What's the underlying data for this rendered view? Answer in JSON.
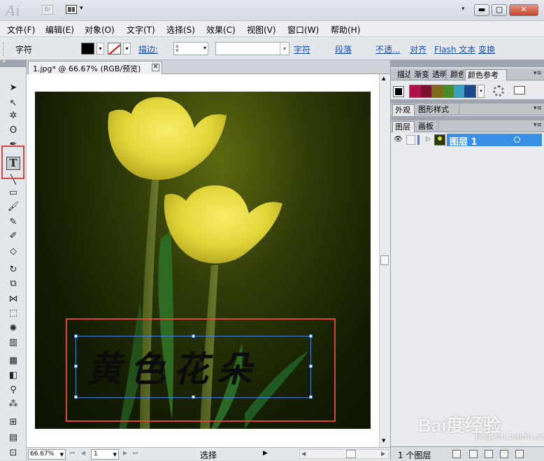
{
  "titlebar": {
    "logo": "Ai",
    "bridge_label": "Br",
    "arrange_dropdown": "▾",
    "workspace_dropdown": "▾",
    "window_buttons": {
      "minimize": "▬",
      "maximize": "▢",
      "close": "✕"
    }
  },
  "menubar": {
    "items": [
      "文件(F)",
      "编辑(E)",
      "对象(O)",
      "文字(T)",
      "选择(S)",
      "效果(C)",
      "视图(V)",
      "窗口(W)",
      "帮助(H)"
    ]
  },
  "controlbar": {
    "tool_label": "字符",
    "fill_color": "#000000",
    "stroke_color": "none",
    "stroke_label": "描边:",
    "stroke_value": "",
    "style_value": "",
    "links": [
      "字符",
      "段落",
      "不透...",
      "对齐",
      "Flash 文本",
      "变换"
    ]
  },
  "tools": {
    "icons": [
      "selection-tool-icon",
      "direct-selection-tool-icon",
      "magic-wand-icon",
      "lasso-icon",
      "pen-icon",
      "type-tool-icon",
      "line-icon",
      "rectangle-icon",
      "paintbrush-icon",
      "pencil-icon",
      "blob-brush-icon",
      "eraser-icon",
      "rotate-icon",
      "scale-icon",
      "width-icon",
      "free-transform-icon",
      "symbol-sprayer-icon",
      "graph-icon",
      "mesh-icon",
      "gradient-icon",
      "eyedropper-icon",
      "blend-icon",
      "slice-icon",
      "hand-icon",
      "artboard-icon"
    ],
    "type_tool_glyph": "T",
    "selected": "type-tool-icon"
  },
  "document": {
    "tab_title": "1.jpg* @ 66.67% (RGB/预览)",
    "tab_close": "✕",
    "artwork_text": "黄色花朵",
    "zoom": "66.67%",
    "page": "1",
    "status": "选择",
    "nav": [
      "⏮",
      "◀",
      "▶",
      "⏭"
    ]
  },
  "panels": {
    "color_tabs": [
      "描边",
      "渐变",
      "透明",
      "颜色",
      "颜色参考"
    ],
    "guide_colors": [
      "#b0104a",
      "#7a1030",
      "#7d6a1a",
      "#4a8a2a",
      "#3aa0c0",
      "#1a4a8a"
    ],
    "appearance_tabs": [
      "外观",
      "图形样式"
    ],
    "layers_tabs": [
      "图层",
      "画板"
    ],
    "layer_name": "图层 1",
    "layer_count": "1 个图层",
    "menu_glyph": "▾≡"
  },
  "watermark": {
    "brand": "Bai度经验",
    "url": "jingyan.baidu.com"
  },
  "colors": {
    "highlight_red": "#d9463d",
    "selection_blue": "#4a7fd6",
    "layer_selected": "#3a8ee6",
    "link_blue": "#1a4fb5"
  }
}
